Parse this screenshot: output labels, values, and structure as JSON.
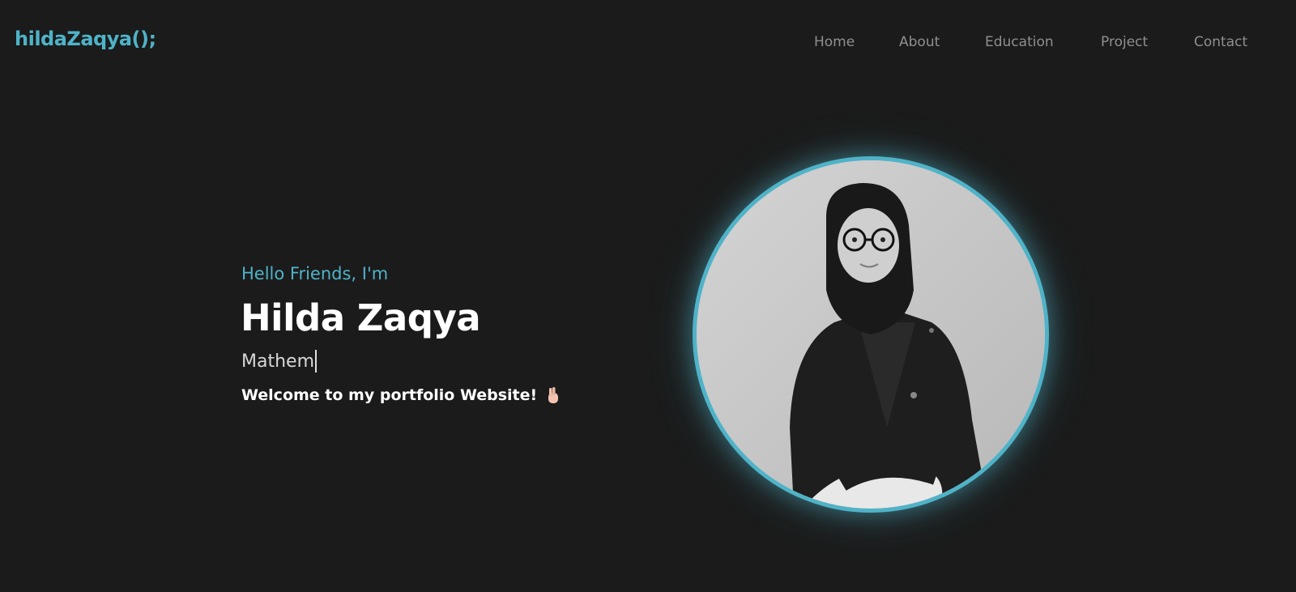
{
  "header": {
    "logo_text": "hildaZaqya();",
    "nav": [
      {
        "label": "Home"
      },
      {
        "label": "About"
      },
      {
        "label": "Education"
      },
      {
        "label": "Project"
      },
      {
        "label": "Contact"
      }
    ]
  },
  "hero": {
    "greeting": "Hello Friends, I'm",
    "name": "Hilda Zaqya",
    "typed_role": "Mathem",
    "welcome": "Welcome to my portfolio Website!",
    "welcome_icon": "hand-emoji-icon"
  },
  "colors": {
    "background": "#1b1b1b",
    "accent": "#4fb3c8",
    "nav_text": "#8f8f8f",
    "heading": "#ffffff"
  }
}
